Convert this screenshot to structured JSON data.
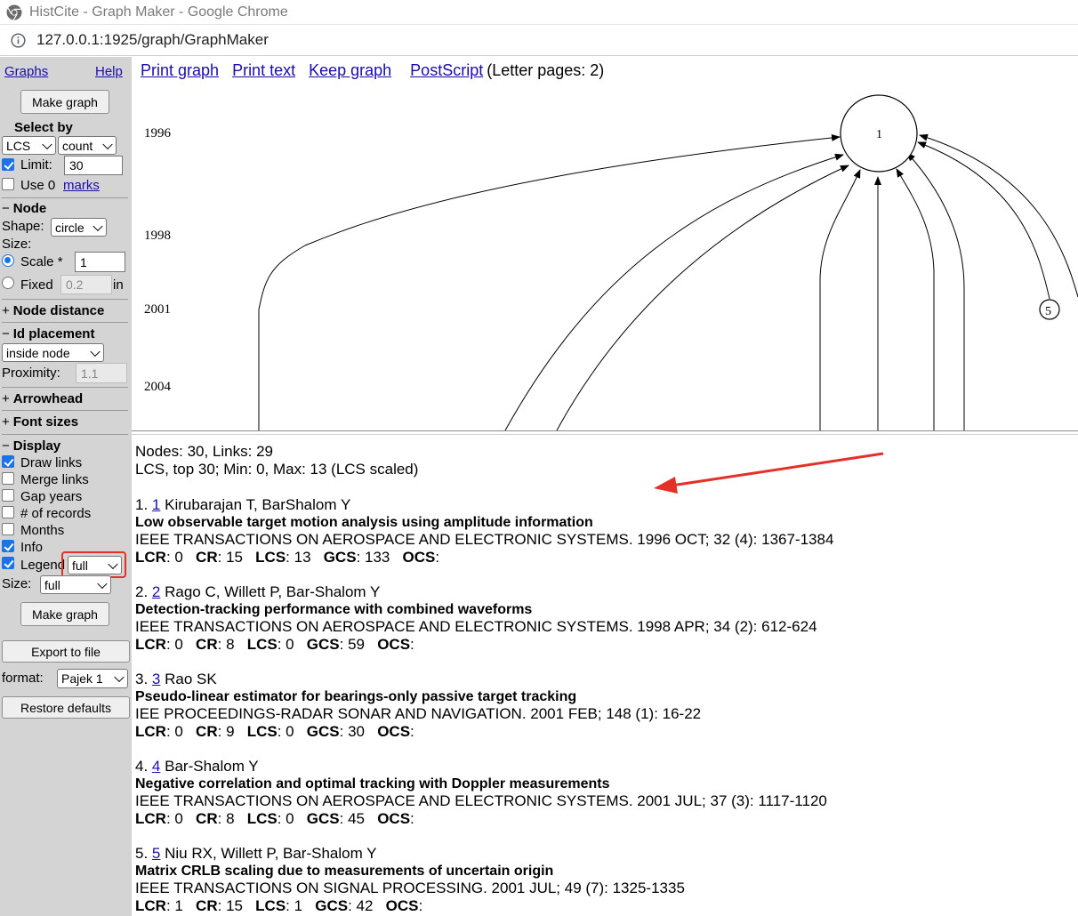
{
  "window": {
    "title": "HistCite - Graph Maker - Google Chrome",
    "url_host": "127.0.0.1",
    "url_rest": ":1925/graph/GraphMaker"
  },
  "colors": {
    "link": "#1a0dab",
    "panel_bg": "#d4d4d4",
    "highlight": "#e5302a",
    "checkbox_on": "#1a73e8"
  },
  "left_panel": {
    "graphs_link": "Graphs",
    "help_link": "Help",
    "make_graph_top": "Make graph",
    "select_by_label": "Select by",
    "select_by_value": "LCS",
    "select_by_mode": "count",
    "limit_label": "Limit:",
    "limit_value": "30",
    "limit_checked": true,
    "use_label": "Use 0",
    "marks_link": "marks",
    "use_checked": false,
    "node_section": {
      "sym": "−",
      "label": "Node"
    },
    "shape_label": "Shape:",
    "shape_value": "circle",
    "size_label": "Size:",
    "scale_label": "Scale *",
    "scale_value": "1",
    "fixed_label": "Fixed",
    "fixed_value": "0.2",
    "fixed_unit": "in",
    "node_distance_section": {
      "sym": "+",
      "label": "Node distance"
    },
    "id_placement_section": {
      "sym": "−",
      "label": "Id placement"
    },
    "id_placement_value": "inside node",
    "proximity_label": "Proximity:",
    "proximity_value": "1.1",
    "arrowhead_section": {
      "sym": "+",
      "label": "Arrowhead"
    },
    "font_sizes_section": {
      "sym": "+",
      "label": "Font sizes"
    },
    "display_section": {
      "sym": "−",
      "label": "Display"
    },
    "display_options": [
      {
        "label": "Draw links",
        "checked": true
      },
      {
        "label": "Merge links",
        "checked": false
      },
      {
        "label": "Gap years",
        "checked": false
      },
      {
        "label": "# of records",
        "checked": false
      },
      {
        "label": "Months",
        "checked": false
      },
      {
        "label": "Info",
        "checked": true
      },
      {
        "label": "Legend",
        "checked": true
      }
    ],
    "legend_value": "full",
    "size2_label": "Size:",
    "size2_value": "full",
    "make_graph_bottom": "Make graph",
    "export_button": "Export to file",
    "format_label": "format:",
    "format_value": "Pajek 1",
    "restore_button": "Restore defaults"
  },
  "graph": {
    "links": {
      "print_graph": "Print graph",
      "print_text": "Print text",
      "keep_graph": "Keep graph",
      "postscript": "PostScript",
      "pages_note": "(Letter pages: 2)"
    },
    "years": [
      "1996",
      "1998",
      "2001",
      "2004"
    ],
    "nodes": [
      {
        "id": "1",
        "icon": "node-circle-large"
      },
      {
        "id": "5",
        "icon": "node-circle-small"
      }
    ]
  },
  "info": {
    "summary_line1": "Nodes: 30, Links: 29",
    "summary_line2": "LCS, top 30; Min: 0, Max: 13 (LCS scaled)",
    "records": [
      {
        "num": "1.",
        "id": "1",
        "authors": "Kirubarajan T, BarShalom Y",
        "title": "Low observable target motion analysis using amplitude information",
        "source": "IEEE TRANSACTIONS ON AEROSPACE AND ELECTRONIC SYSTEMS. 1996 OCT; 32 (4): 1367-1384",
        "lcr": "0",
        "cr": "15",
        "lcs": "13",
        "gcs": "133",
        "ocs": ""
      },
      {
        "num": "2.",
        "id": "2",
        "authors": "Rago C, Willett P, Bar-Shalom Y",
        "title": "Detection-tracking performance with combined waveforms",
        "source": "IEEE TRANSACTIONS ON AEROSPACE AND ELECTRONIC SYSTEMS. 1998 APR; 34 (2): 612-624",
        "lcr": "0",
        "cr": "8",
        "lcs": "0",
        "gcs": "59",
        "ocs": ""
      },
      {
        "num": "3.",
        "id": "3",
        "authors": "Rao SK",
        "title": "Pseudo-linear estimator for bearings-only passive target tracking",
        "source": "IEE PROCEEDINGS-RADAR SONAR AND NAVIGATION. 2001 FEB; 148 (1): 16-22",
        "lcr": "0",
        "cr": "9",
        "lcs": "0",
        "gcs": "30",
        "ocs": ""
      },
      {
        "num": "4.",
        "id": "4",
        "authors": "Bar-Shalom Y",
        "title": "Negative correlation and optimal tracking with Doppler measurements",
        "source": "IEEE TRANSACTIONS ON AEROSPACE AND ELECTRONIC SYSTEMS. 2001 JUL; 37 (3): 1117-1120",
        "lcr": "0",
        "cr": "8",
        "lcs": "0",
        "gcs": "45",
        "ocs": ""
      },
      {
        "num": "5.",
        "id": "5",
        "authors": "Niu RX, Willett P, Bar-Shalom Y",
        "title": "Matrix CRLB scaling due to measurements of uncertain origin",
        "source": "IEEE TRANSACTIONS ON SIGNAL PROCESSING. 2001 JUL; 49 (7): 1325-1335",
        "lcr": "1",
        "cr": "15",
        "lcs": "1",
        "gcs": "42",
        "ocs": ""
      }
    ],
    "field_labels": {
      "lcr": "LCR",
      "cr": "CR",
      "lcs": "LCS",
      "gcs": "GCS",
      "ocs": "OCS"
    }
  }
}
